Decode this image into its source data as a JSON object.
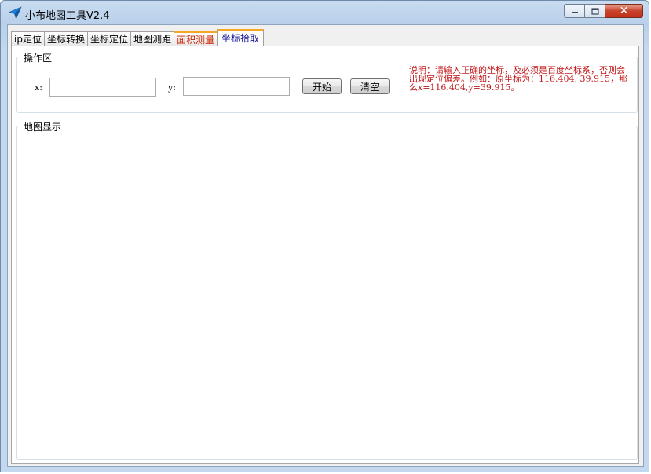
{
  "window": {
    "title": "小布地图工具V2.4",
    "icon": "navigation-arrow-icon",
    "controls": {
      "minimize": "minimize-icon",
      "maximize": "maximize-icon",
      "close": "✕"
    }
  },
  "tabs": [
    {
      "label": "ip定位",
      "state": "normal"
    },
    {
      "label": "坐标转换",
      "state": "normal"
    },
    {
      "label": "坐标定位",
      "state": "normal"
    },
    {
      "label": "地图测距",
      "state": "normal"
    },
    {
      "label": "面积测量",
      "state": "highlighted"
    },
    {
      "label": "坐标拾取",
      "state": "active"
    }
  ],
  "operation_group": {
    "title": "操作区",
    "x_label": "x:",
    "x_value": "",
    "y_label": "y:",
    "y_value": "",
    "start_button": "开始",
    "clear_button": "清空",
    "note": "说明：请输入正确的坐标，及必须是百度坐标系，否则会出现定位偏差。例如：原坐标为：116.404, 39.915，那么x=116.404,y=39.915。"
  },
  "map_group": {
    "title": "地图显示"
  },
  "colors": {
    "note_text": "#c0181a",
    "active_tab_text": "#1a1a9a",
    "highlight_tab_text": "#cc2200",
    "tab_accent": "#f5a623"
  }
}
